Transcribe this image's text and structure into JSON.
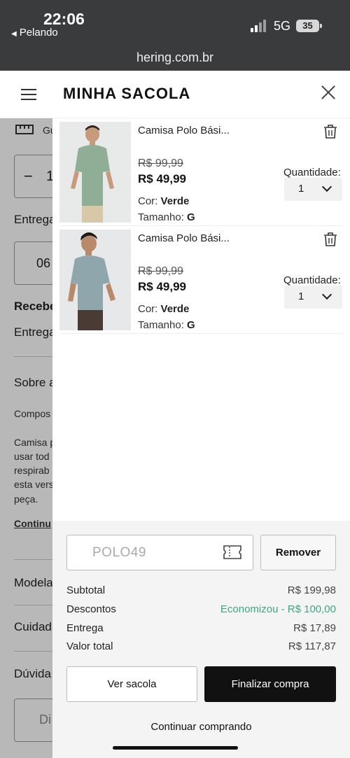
{
  "status": {
    "time": "22:06",
    "back_app": "Pelando",
    "network": "5G",
    "battery": "35"
  },
  "browser": {
    "url": "hering.com.br"
  },
  "background_page": {
    "guide": "Gu",
    "qty_value": "1",
    "delivery": "Entrega",
    "cep": "06",
    "receive": "Recebe",
    "delivery2": "Entrega",
    "about": "Sobre a",
    "composition": "Compos",
    "desc_lines": [
      "Camisa p",
      "usar tod",
      "respirab",
      "esta vers",
      "peça."
    ],
    "continue_link": "Continu",
    "model": "Modela",
    "care": "Cuidad",
    "doubts": "Dúvida",
    "bottom_btn": "Di"
  },
  "drawer": {
    "title": "MINHA SACOLA",
    "items": [
      {
        "name": "Camisa Polo Bási...",
        "old_price": "R$ 99,99",
        "price": "R$ 49,99",
        "color_label": "Cor:",
        "color": "Verde",
        "size_label": "Tamanho:",
        "size": "G",
        "qty_label": "Quantidade:",
        "qty": "1",
        "shirt_color": "#8fae95"
      },
      {
        "name": "Camisa Polo Bási...",
        "old_price": "R$ 99,99",
        "price": "R$ 49,99",
        "color_label": "Cor:",
        "color": "Verde",
        "size_label": "Tamanho:",
        "size": "G",
        "qty_label": "Quantidade:",
        "qty": "1",
        "shirt_color": "#8fa6ad"
      }
    ]
  },
  "summary": {
    "coupon_code": "POLO49",
    "remove_label": "Remover",
    "subtotal_label": "Subtotal",
    "subtotal": "R$ 199,98",
    "discount_label": "Descontos",
    "discount": "Economizou - R$ 100,00",
    "delivery_label": "Entrega",
    "delivery": "R$ 17,89",
    "total_label": "Valor total",
    "total": "R$ 117,87",
    "view_bag": "Ver sacola",
    "checkout": "Finalizar compra",
    "continue": "Continuar comprando"
  }
}
